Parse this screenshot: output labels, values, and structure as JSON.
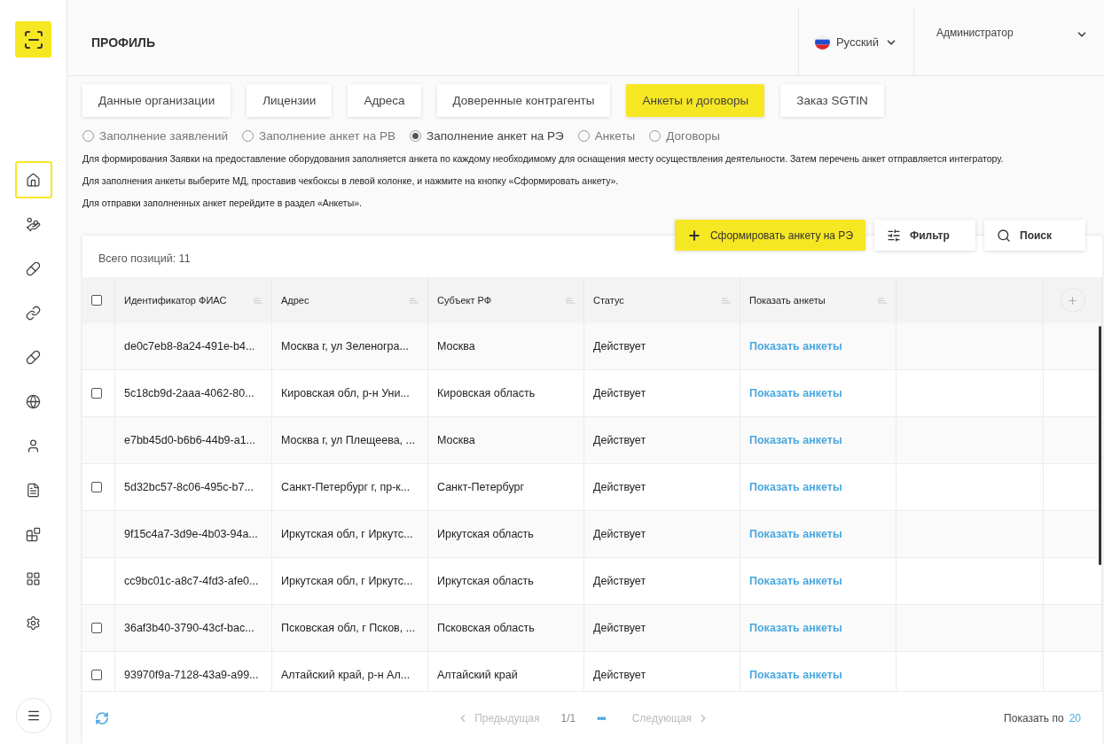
{
  "sidebar": {
    "items": [
      {
        "selected": true
      },
      {
        "selected": false
      },
      {
        "selected": false
      },
      {
        "selected": false
      },
      {
        "selected": false
      },
      {
        "selected": false
      },
      {
        "selected": false
      },
      {
        "selected": false
      },
      {
        "selected": false
      },
      {
        "selected": false
      },
      {
        "selected": false
      }
    ]
  },
  "header": {
    "title": "ПРОФИЛЬ",
    "language": "Русский",
    "user": "Администратор"
  },
  "tabs": [
    {
      "label": "Данные организации",
      "selected": false
    },
    {
      "label": "Лицензии",
      "selected": false
    },
    {
      "label": "Адреса",
      "selected": false
    },
    {
      "label": "Доверенные контрагенты",
      "selected": false
    },
    {
      "label": "Анкеты и договоры",
      "selected": true
    },
    {
      "label": "Заказ SGTIN",
      "selected": false
    }
  ],
  "radios": [
    {
      "label": "Заполнение заявлений",
      "selected": false
    },
    {
      "label": "Заполнение анкет на РВ",
      "selected": false
    },
    {
      "label": "Заполнение анкет на РЭ",
      "selected": true
    },
    {
      "label": "Анкеты",
      "selected": false
    },
    {
      "label": "Договоры",
      "selected": false
    }
  ],
  "info": [
    "Для формирования Заявки на предоставление оборудования заполняется анкета по каждому необходимому для оснащения месту осуществления деятельности. Затем перечень анкет отправляется интегратору.",
    "Для заполнения анкеты выберите МД, проставив чекбоксы в левой колонке, и нажмите на кнопку «Сформировать анкету».",
    "Для отправки заполненных анкет перейдите в раздел «Анкеты»."
  ],
  "actions": [
    {
      "kind": "primary",
      "label": "Сформировать анкету на РЭ"
    },
    {
      "kind": "filter",
      "label": "Фильтр"
    },
    {
      "kind": "search",
      "label": "Поиск"
    }
  ],
  "table": {
    "total": "Всего позиций: 11",
    "header_checked": false,
    "columns": [
      "Идентификатор ФИАС",
      "Адрес",
      "Субъект РФ",
      "Статус",
      "Показать анкеты"
    ],
    "rows": [
      {
        "checkable": false,
        "cells": [
          "de0c7eb8-8a24-491e-b4...",
          "Москва г, ул Зеленогра...",
          "Москва",
          "Действует"
        ],
        "link": "Показать анкеты"
      },
      {
        "checkable": true,
        "checked": false,
        "cells": [
          "5c18cb9d-2aaa-4062-80...",
          "Кировская обл, р-н Уни...",
          "Кировская область",
          "Действует"
        ],
        "link": "Показать анкеты"
      },
      {
        "checkable": false,
        "cells": [
          "e7bb45d0-b6b6-44b9-a1...",
          "Москва г, ул Плещеева, ...",
          "Москва",
          "Действует"
        ],
        "link": "Показать анкеты"
      },
      {
        "checkable": true,
        "checked": false,
        "cells": [
          "5d32bc57-8c06-495c-b7...",
          "Санкт-Петербург г, пр-к...",
          "Санкт-Петербург",
          "Действует"
        ],
        "link": "Показать анкеты"
      },
      {
        "checkable": false,
        "cells": [
          "9f15c4a7-3d9e-4b03-94a...",
          "Иркутская обл, г Иркутс...",
          "Иркутская область",
          "Действует"
        ],
        "link": "Показать анкеты"
      },
      {
        "checkable": false,
        "cells": [
          "cc9bc01c-a8c7-4fd3-afe0...",
          "Иркутская обл, г Иркутс...",
          "Иркутская область",
          "Действует"
        ],
        "link": "Показать анкеты"
      },
      {
        "checkable": true,
        "checked": false,
        "cells": [
          "36af3b40-3790-43cf-bac...",
          "Псковская обл, г Псков, ...",
          "Псковская область",
          "Действует"
        ],
        "link": "Показать анкеты"
      },
      {
        "checkable": true,
        "checked": false,
        "cells": [
          "93970f9a-7128-43a9-a99...",
          "Алтайский край, р-н Ал...",
          "Алтайский край",
          "Действует"
        ],
        "link": "Показать анкеты"
      }
    ]
  },
  "pagination": {
    "prev": "Предыдущая",
    "page": "1/1",
    "more": "•••",
    "next": "Следующая",
    "page_size_label": "Показать по",
    "page_size": "20"
  }
}
